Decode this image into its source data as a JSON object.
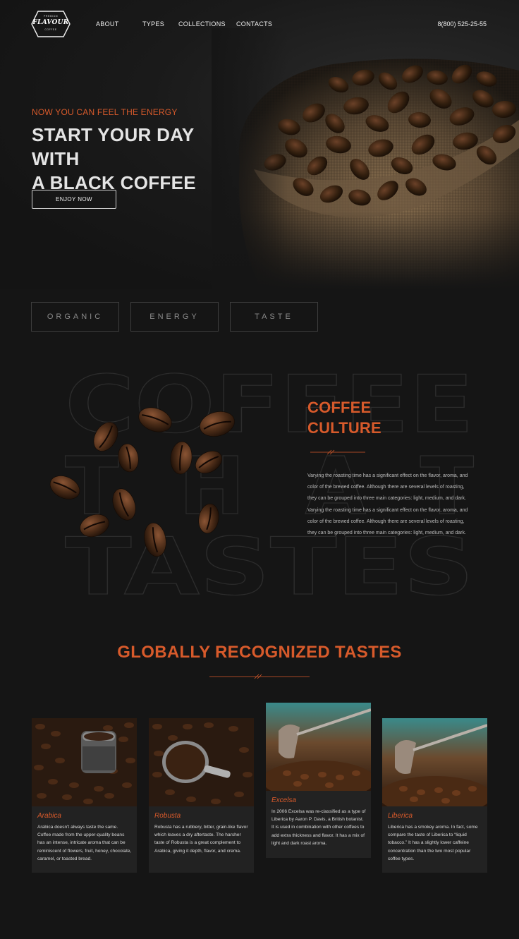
{
  "logo": {
    "top": "PREMIUM",
    "name": "FLAVOUR",
    "bottom": "COFFEE"
  },
  "nav": {
    "links": [
      "ABOUT",
      "TYPES",
      "COLLECTIONS",
      "CONTACTS"
    ],
    "phone": "8(800) 525-25-55"
  },
  "hero": {
    "kicker": "NOW YOU CAN FEEL THE ENERGY",
    "title_line1": "START YOUR DAY WITH",
    "title_line2": "A BLACK COFFEE",
    "button": "ENJOY NOW"
  },
  "features": [
    "ORGANIC",
    "ENERGY",
    "TASTE"
  ],
  "background_text": [
    "COFFEE",
    "THAT",
    "TASTES"
  ],
  "culture": {
    "title_line1": "COFFEE",
    "title_line2": "CULTURE",
    "paragraph1": "Varying the roasting time has a significant effect on the flavor, aroma, and color of the brewed coffee. Although there are several levels of roasting, they can be grouped into three main categories: light, medium, and dark.",
    "paragraph2": "Varying the roasting time has a significant effect on the flavor, aroma, and color of the brewed coffee. Although there are several levels of roasting, they can be grouped into three main categories: light, medium, and dark."
  },
  "tastes": {
    "title": "GLOBALLY RECOGNIZED TASTES",
    "cards": [
      {
        "name": "Arabica",
        "desc": "Arabica doesn't always taste the same. Coffee made from the upper-quality beans has an intense, intricate aroma that can be reminiscent of flowers, fruit, honey, chocolate, caramel, or toasted bread."
      },
      {
        "name": "Robusta",
        "desc": "Robusta has a rubbery, bitter, grain-like flavor which leaves a dry aftertaste. The harsher taste of Robusta is a great complement to Arabica, giving it depth, flavor, and crema."
      },
      {
        "name": "Excelsa",
        "desc": "In 2006  Excelsa was re-classified as a type of Liberica by Aaron P. Davis, a British botanist. It is used in combination with other coffees to add extra thickness and flavor. It has a mix of light and dark roast aroma."
      },
      {
        "name": "Liberica",
        "desc": "Liberica has a smokey aroma. In fact, some compare the taste of Liberica to “liquid tobacco.” It has a slightly lower caffeine concentration than the two most popular coffee types."
      }
    ]
  },
  "colors": {
    "accent": "#d75a2b",
    "background": "#151515",
    "card": "#222222"
  }
}
